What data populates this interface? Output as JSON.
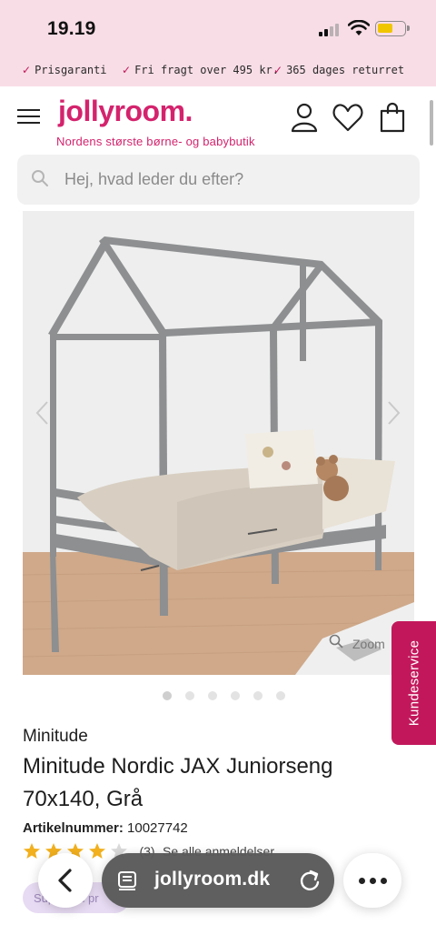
{
  "status_bar": {
    "time": "19.19"
  },
  "promo": {
    "items": [
      {
        "label": "Prisgaranti"
      },
      {
        "label": "Fri fragt over 495 kr."
      },
      {
        "label": "365 dages returret"
      }
    ]
  },
  "header": {
    "logo": "jollyroom.",
    "tagline": "Nordens største børne- og babybutik",
    "icons": [
      "account-icon",
      "heart-icon",
      "cart-icon"
    ]
  },
  "search": {
    "placeholder": "Hej, hvad leder du efter?"
  },
  "gallery": {
    "zoom_label": "Zoom",
    "total_images": 6,
    "active_index": 0
  },
  "kundeservice": {
    "label": "Kundeservice"
  },
  "product": {
    "brand": "Minitude",
    "title": "Minitude Nordic JAX Juniorseng 70x140, Grå",
    "article_label": "Artikelnummer:",
    "article_number": "10027742",
    "rating": 4,
    "rating_max": 5,
    "review_count": "(3)",
    "reviews_link": "Se alle anmeldelser",
    "badge": "Superbud pr"
  },
  "browser": {
    "domain": "jollyroom.dk"
  },
  "colors": {
    "brand": "#d4236d",
    "promo_bg": "#f8dde6",
    "kunde_bg": "#c2185b",
    "star": "#f2b01e"
  }
}
